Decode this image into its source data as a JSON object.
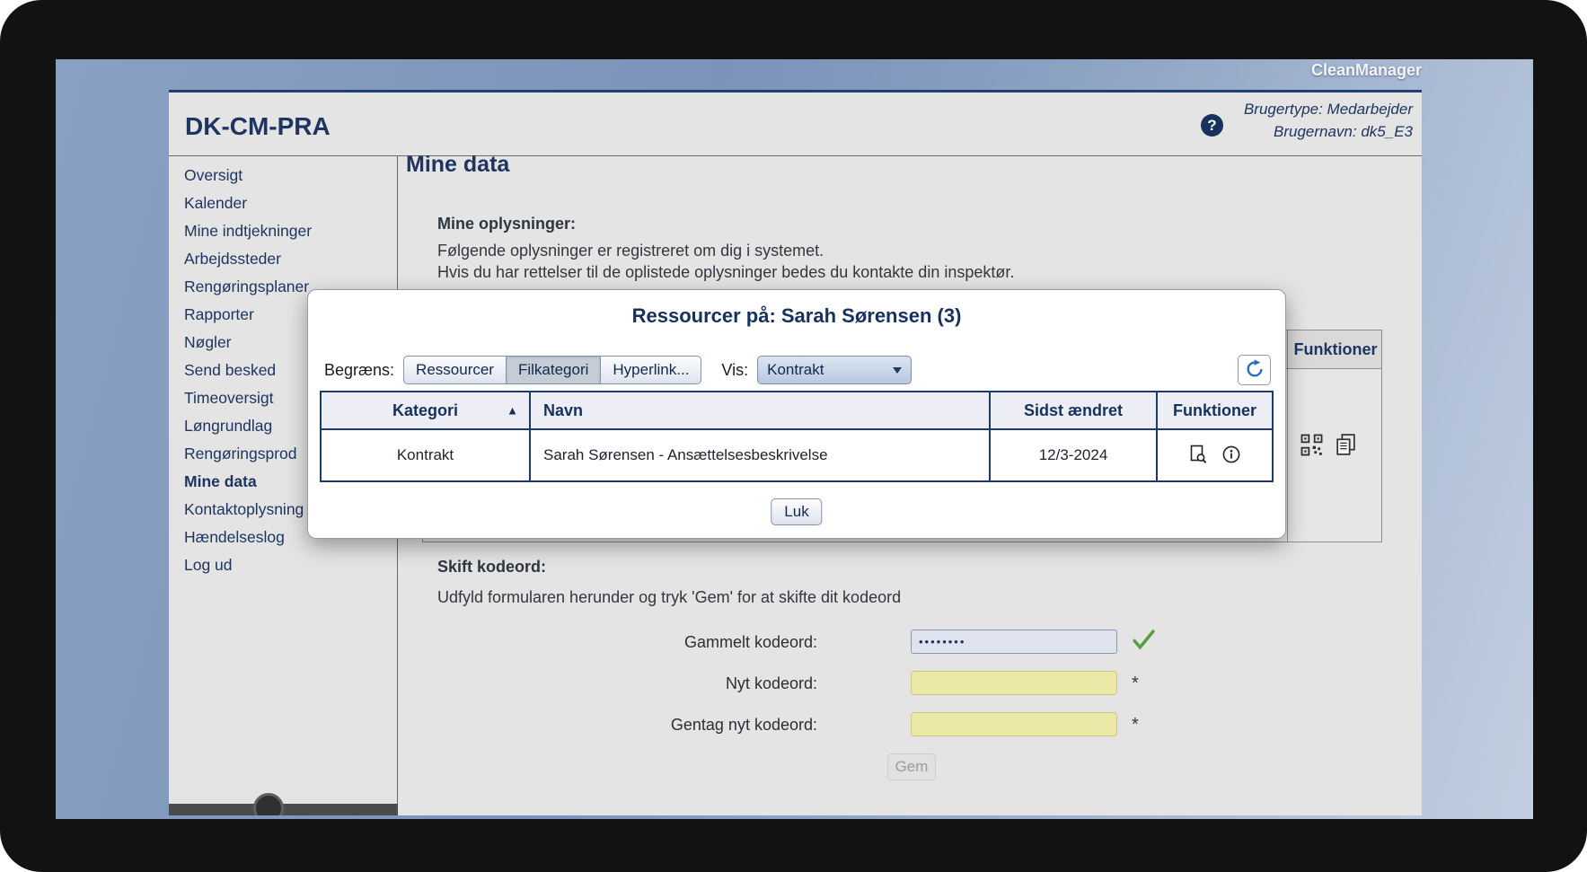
{
  "brand": "CleanManager",
  "header": {
    "app_title": "DK-CM-PRA",
    "help_glyph": "?",
    "user_type": "Brugertype: Medarbejder",
    "user_name": "Brugernavn: dk5_E3"
  },
  "sidebar": {
    "items": [
      {
        "label": "Oversigt"
      },
      {
        "label": "Kalender"
      },
      {
        "label": "Mine indtjekninger"
      },
      {
        "label": "Arbejdssteder"
      },
      {
        "label": "Rengøringsplaner"
      },
      {
        "label": "Rapporter"
      },
      {
        "label": "Nøgler"
      },
      {
        "label": "Send besked"
      },
      {
        "label": "Timeoversigt"
      },
      {
        "label": "Løngrundlag"
      },
      {
        "label": "Rengøringsprod"
      },
      {
        "label": "Mine data",
        "active": true
      },
      {
        "label": "Kontaktoplysning"
      },
      {
        "label": "Hændelseslog"
      },
      {
        "label": "Log ud"
      }
    ]
  },
  "main": {
    "title": "Mine data",
    "info": {
      "heading": "Mine oplysninger:",
      "line1": "Følgende oplysninger er registreret om dig i systemet.",
      "line2": "Hvis du har rettelser til de oplistede oplysninger bedes du kontakte din inspektør."
    },
    "resources_table": {
      "funktioner_header": "Funktioner"
    },
    "password": {
      "heading": "Skift kodeord:",
      "description": "Udfyld formularen herunder og tryk 'Gem' for at skifte dit kodeord",
      "old_label": "Gammelt kodeord:",
      "old_value": "••••••••",
      "new_label": "Nyt kodeord:",
      "repeat_label": "Gentag nyt kodeord:",
      "required_marker": "*",
      "save_label": "Gem"
    }
  },
  "modal": {
    "title": "Ressourcer på: Sarah Sørensen (3)",
    "filter_label": "Begræns:",
    "filters": [
      {
        "label": "Ressourcer",
        "selected": false
      },
      {
        "label": "Filkategori",
        "selected": true
      },
      {
        "label": "Hyperlink...",
        "selected": false
      }
    ],
    "vis_label": "Vis:",
    "vis_selected": "Kontrakt",
    "table": {
      "col_kategori": "Kategori",
      "col_navn": "Navn",
      "col_sidst": "Sidst ændret",
      "col_funktioner": "Funktioner",
      "sort_glyph": "▲",
      "rows": [
        {
          "kategori": "Kontrakt",
          "navn": "Sarah Sørensen - Ansættelsesbeskrivelse",
          "sidst": "12/3-2024"
        }
      ]
    },
    "close_label": "Luk"
  },
  "colors": {
    "navy": "#1d3560",
    "accent_blue": "#2a6db8",
    "field_yellow": "#ece9a8",
    "check_green": "#54a03e"
  }
}
